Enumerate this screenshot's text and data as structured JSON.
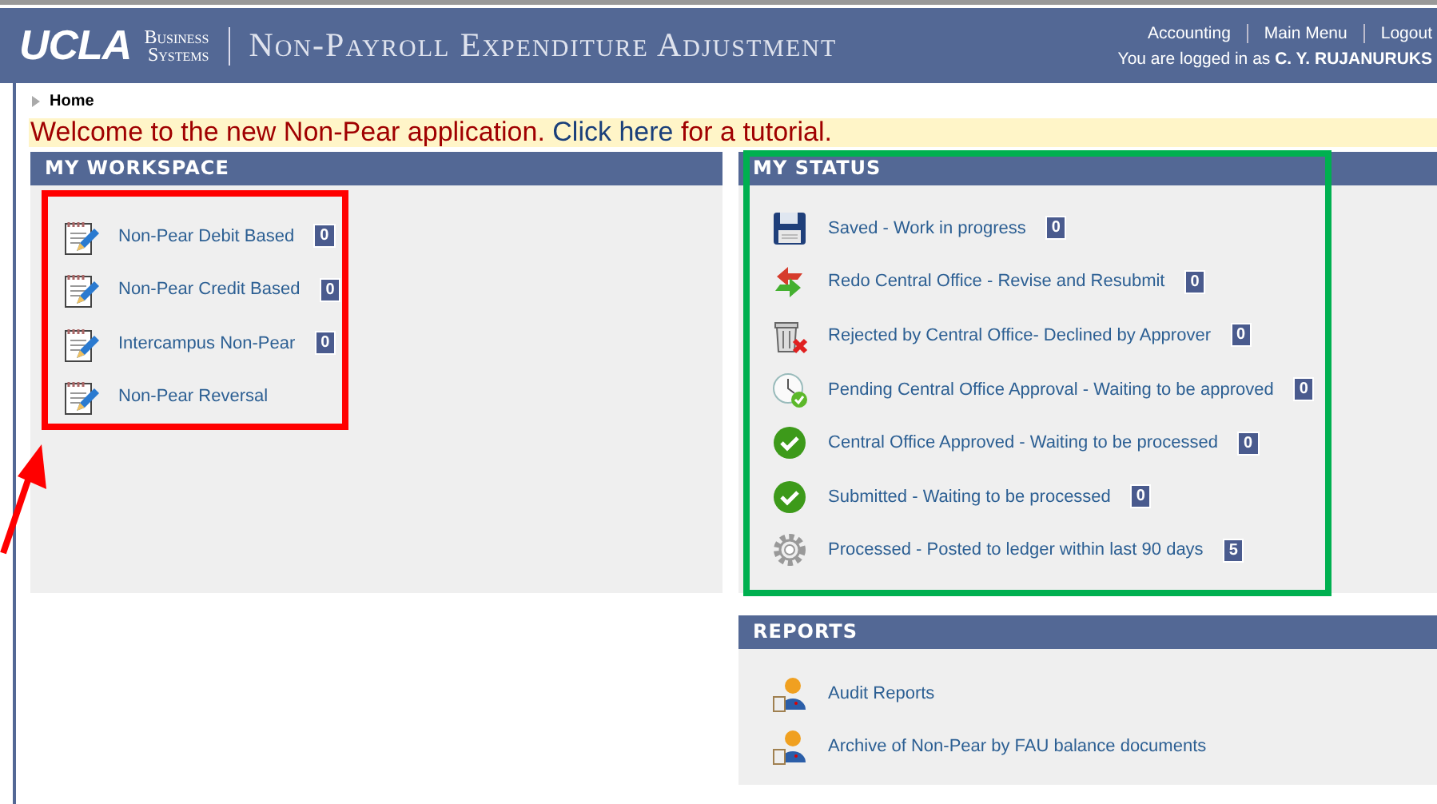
{
  "header": {
    "logo": "UCLA",
    "logo_sub": [
      "Business",
      "Systems"
    ],
    "title": "Non-Payroll Expenditure Adjustment",
    "nav": [
      "Accounting",
      "Main Menu",
      "Logout"
    ],
    "login": "You are logged in as **C. Y. RUJANURUKS**"
  },
  "breadcrumb": "Home",
  "welcome": {
    "before": "Welcome to the new Non-Pear application. ",
    "link": "Click here",
    "after": " for a tutorial."
  },
  "workspace": {
    "title": "MY WORKSPACE",
    "items": [
      {
        "kind": "notepad",
        "label": "Non-Pear Debit Based",
        "count": "0"
      },
      {
        "kind": "notepad",
        "label": "Non-Pear Credit Based",
        "count": "0"
      },
      {
        "kind": "notepad",
        "label": "Intercampus Non-Pear",
        "count": "0"
      },
      {
        "kind": "notepad",
        "label": "Non-Pear Reversal"
      }
    ]
  },
  "status": {
    "title": "MY STATUS",
    "items": [
      {
        "kind": "floppy",
        "label": "Saved - Work in progress",
        "count": "0"
      },
      {
        "kind": "redo",
        "label": "Redo Central Office - Revise and Resubmit",
        "count": "0"
      },
      {
        "kind": "trash",
        "label": "Rejected by Central Office- Declined by Approver",
        "count": "0"
      },
      {
        "kind": "clock",
        "label": "Pending Central Office Approval - Waiting to be approved",
        "count": "0"
      },
      {
        "kind": "check",
        "label": "Central Office Approved - Waiting to be processed",
        "count": "0"
      },
      {
        "kind": "check",
        "label": "Submitted - Waiting to be processed",
        "count": "0"
      },
      {
        "kind": "gear",
        "label": "Processed - Posted to ledger within last 90 days",
        "count": "5"
      }
    ]
  },
  "reports": {
    "title": "REPORTS",
    "items": [
      {
        "kind": "person",
        "label": "Audit Reports"
      },
      {
        "kind": "person",
        "label": "Archive of Non-Pear by FAU balance documents"
      }
    ]
  }
}
